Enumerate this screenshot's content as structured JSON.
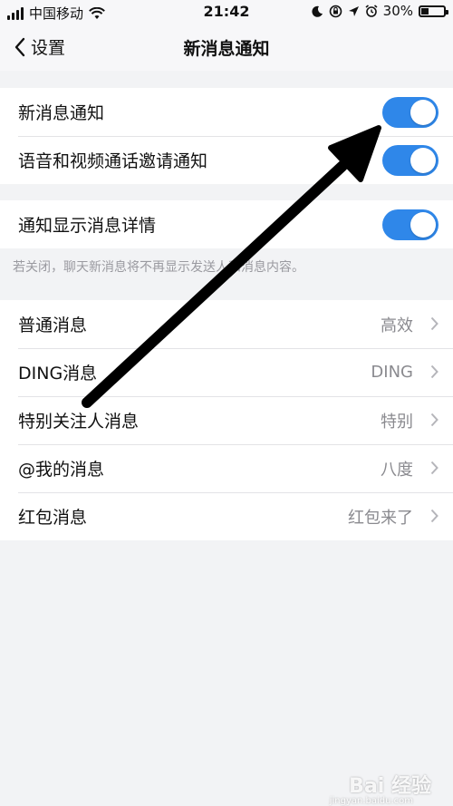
{
  "status_bar": {
    "carrier": "中国移动",
    "time": "21:42",
    "battery": "30%",
    "battery_level": 0.3,
    "icons": [
      "signal-icon",
      "wifi-icon",
      "moon-icon",
      "lock-rotation-icon",
      "location-icon",
      "alarm-icon",
      "battery-icon"
    ]
  },
  "nav": {
    "back_label": "设置",
    "title": "新消息通知"
  },
  "settings_group_1": [
    {
      "label": "新消息通知",
      "enabled": true
    },
    {
      "label": "语音和视频通话邀请通知",
      "enabled": true
    }
  ],
  "settings_group_2": [
    {
      "label": "通知显示消息详情",
      "enabled": true
    }
  ],
  "hint_text": "若关闭，聊天新消息将不再显示发送人和消息内容。",
  "message_types": [
    {
      "label": "普通消息",
      "value": "高效"
    },
    {
      "label": "DING消息",
      "value": "DING"
    },
    {
      "label": "特别关注人消息",
      "value": "特别"
    },
    {
      "label": "@我的消息",
      "value": "八度"
    },
    {
      "label": "红包消息",
      "value": "红包来了"
    }
  ],
  "watermark": {
    "brand": "Bai 经验",
    "url": "jingyan.baidu.com"
  },
  "colors": {
    "toggle_on": "#2f87e9",
    "background": "#f2f3f5",
    "annotation_arrow": "#000000"
  }
}
